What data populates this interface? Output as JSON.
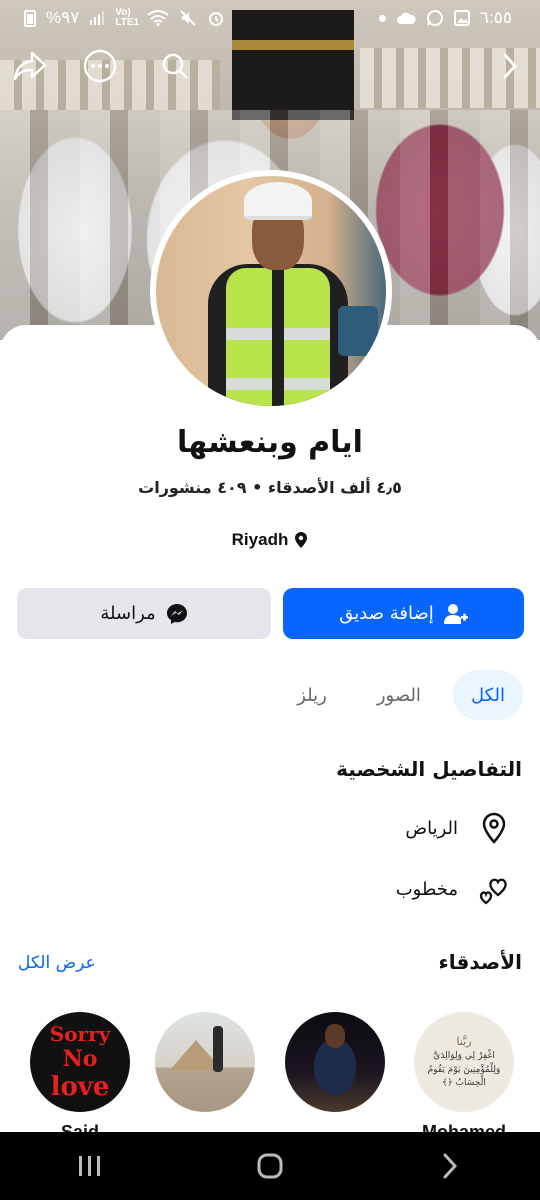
{
  "status_bar": {
    "time": "٦:٥٥",
    "battery": "%٩٧",
    "network": "Vo) LTE1",
    "icons": [
      "photo-icon",
      "whatsapp-icon",
      "cloud-icon",
      "dot-icon",
      "alarm-icon",
      "mute-icon",
      "wifi-icon",
      "signal-icon",
      "battery-icon"
    ]
  },
  "top_actions": {
    "icons": [
      "back-icon",
      "search-icon",
      "more-icon",
      "share-icon"
    ]
  },
  "profile": {
    "name": "ايام وبنعشها",
    "stats": "٤٫٥ ألف الأصدقاء • ٤٠٩ منشورات",
    "location": "Riyadh"
  },
  "buttons": {
    "add_friend": "إضافة صديق",
    "message": "مراسلة"
  },
  "tabs": [
    {
      "label": "الكل",
      "active": true
    },
    {
      "label": "الصور",
      "active": false
    },
    {
      "label": "ريلز",
      "active": false
    }
  ],
  "details": {
    "title": "التفاصيل الشخصية",
    "items": [
      {
        "icon": "location-icon",
        "text": "الرياض"
      },
      {
        "icon": "hearts-icon",
        "text": "مخطوب"
      }
    ]
  },
  "friends": {
    "title": "الأصدقاء",
    "see_all": "عرض الكل",
    "items": [
      {
        "name": "Said",
        "photo_text": [
          "Sorry",
          "No",
          "love"
        ]
      },
      {
        "name": "...",
        "photo_text": []
      },
      {
        "name": "...",
        "photo_text": []
      },
      {
        "name": "Mohamed",
        "photo_text": [
          "ربَّنا",
          "اغْفِرْ لِي وَلِوَالِدَيَّ",
          "وَلِلْمُؤْمِنِينَ يَوْمَ يَقُومُ",
          "الْحِسَابُ ﴿﴾"
        ]
      }
    ]
  },
  "colors": {
    "primary": "#0866ff",
    "secondary_button": "#e4e6eb",
    "active_tab_bg": "#ebf5ff"
  }
}
